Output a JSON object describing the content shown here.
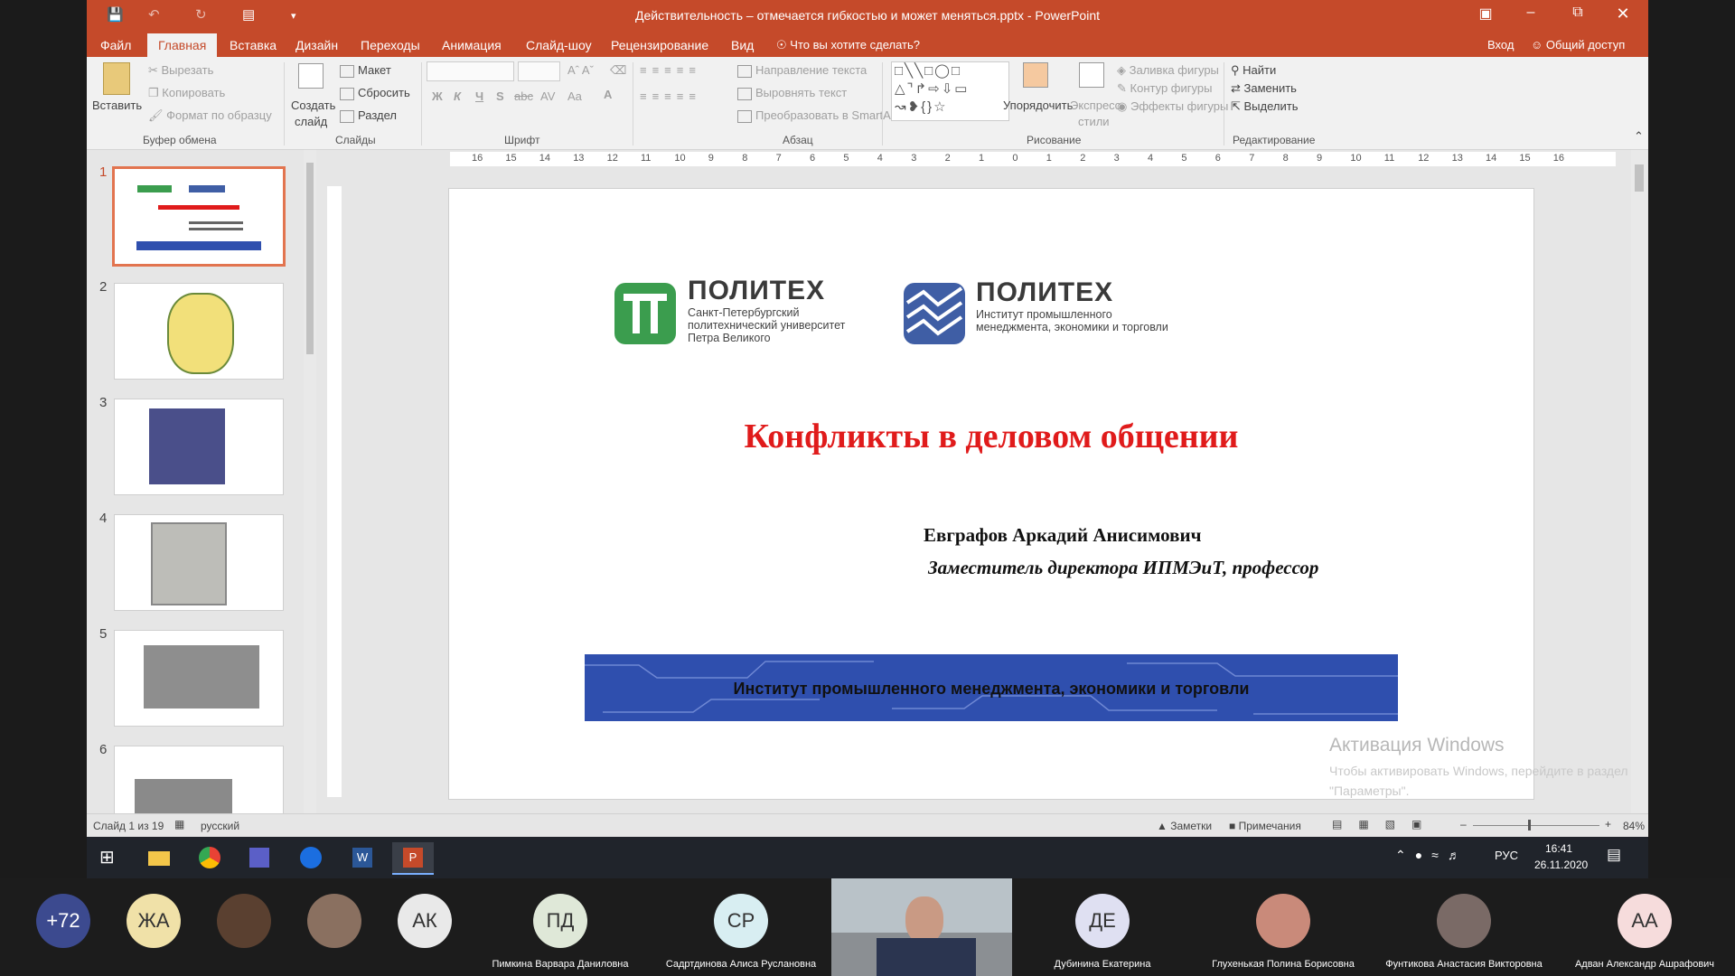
{
  "window": {
    "title": "Действительность – отмечается гибкостью и может меняться.pptx - PowerPoint"
  },
  "tabs": [
    {
      "label": "Файл"
    },
    {
      "label": "Главная"
    },
    {
      "label": "Вставка"
    },
    {
      "label": "Дизайн"
    },
    {
      "label": "Переходы"
    },
    {
      "label": "Анимация"
    },
    {
      "label": "Слайд-шоу"
    },
    {
      "label": "Рецензирование"
    },
    {
      "label": "Вид"
    }
  ],
  "tell_me": "Что вы хотите сделать?",
  "account": {
    "signin": "Вход",
    "share": "Общий доступ"
  },
  "ribbon": {
    "clipboard": {
      "paste": "Вставить",
      "cut": "Вырезать",
      "copy": "Копировать",
      "format_painter": "Формат по образцу",
      "group": "Буфер обмена"
    },
    "slides": {
      "new_slide_1": "Создать",
      "new_slide_2": "слайд",
      "layout": "Макет",
      "reset": "Сбросить",
      "section": "Раздел",
      "group": "Слайды"
    },
    "font": {
      "group": "Шрифт",
      "bold": "Ж",
      "italic": "К",
      "underline": "Ч",
      "strike": "S",
      "abc": "abc",
      "spacing": "AV",
      "case": "Aa"
    },
    "paragraph": {
      "text_direction": "Направление текста",
      "align_text": "Выровнять текст",
      "smartart": "Преобразовать в SmartArt",
      "group": "Абзац"
    },
    "drawing": {
      "arrange": "Упорядочить",
      "quick_styles_1": "Экспресс-",
      "quick_styles_2": "стили",
      "fill": "Заливка фигуры",
      "outline": "Контур фигуры",
      "effects": "Эффекты фигуры",
      "group": "Рисование"
    },
    "editing": {
      "find": "Найти",
      "replace": "Заменить",
      "select": "Выделить",
      "group": "Редактирование"
    }
  },
  "thumbnails": [
    "1",
    "2",
    "3",
    "4",
    "5",
    "6"
  ],
  "hruler": [
    "16",
    "15",
    "14",
    "13",
    "12",
    "11",
    "10",
    "9",
    "8",
    "7",
    "6",
    "5",
    "4",
    "3",
    "2",
    "1",
    "0",
    "1",
    "2",
    "3",
    "4",
    "5",
    "6",
    "7",
    "8",
    "9",
    "10",
    "11",
    "12",
    "13",
    "14",
    "15",
    "16"
  ],
  "slide": {
    "logo1": {
      "name": "ПОЛИТЕХ",
      "sub1": "Санкт-Петербургский",
      "sub2": "политехнический университет",
      "sub3": "Петра Великого"
    },
    "logo2": {
      "name": "ПОЛИТЕХ",
      "sub1": "Институт промышленного",
      "sub2": "менеджмента, экономики и торговли"
    },
    "title": "Конфликты в деловом общении",
    "author": "Евграфов Аркадий Анисимович",
    "position": "Заместитель директора   ИПМЭиТ, профессор",
    "banner": "Институт промышленного менеджмента, экономики и торговли"
  },
  "activation": {
    "title": "Активация Windows",
    "line1": "Чтобы активировать Windows, перейдите в раздел",
    "line2": "\"Параметры\"."
  },
  "status": {
    "slide": "Слайд 1 из 19",
    "language": "русский",
    "notes": "Заметки",
    "comments": "Примечания",
    "zoom": "84%"
  },
  "tray": {
    "lang": "РУС",
    "time": "16:41",
    "date": "26.11.2020"
  },
  "participants": [
    {
      "initials": "+72",
      "color": "#3c4a8f",
      "text": "#ffffff"
    },
    {
      "initials": "ЖА",
      "color": "#f0e1a8",
      "text": "#333333"
    },
    {
      "initials": "",
      "color": "#5a4030",
      "text": "#ffffff"
    },
    {
      "initials": "",
      "color": "#8a7060",
      "text": "#ffffff"
    },
    {
      "initials": "АК",
      "color": "#e9e9e9",
      "text": "#333333"
    },
    {
      "initials": "ПД",
      "color": "#dfe8d8",
      "text": "#333333",
      "name": "Пимкина Варвара Даниловна"
    },
    {
      "initials": "СР",
      "color": "#d8eef2",
      "text": "#333333",
      "name": "Садртдинова Алиса Руслановна"
    },
    {
      "initials": "",
      "name": ""
    },
    {
      "initials": "ДЕ",
      "color": "#dfe0f2",
      "text": "#333333",
      "name": "Дубинина Екатерина"
    },
    {
      "initials": "",
      "color": "#c98a7a",
      "text": "#ffffff",
      "name": "Глухенькая Полина Борисовна"
    },
    {
      "initials": "",
      "color": "#7a6a66",
      "text": "#ffffff",
      "name": "Фунтикова Анастасия Викторовна"
    },
    {
      "initials": "АА",
      "color": "#f6dcdc",
      "text": "#333333",
      "name": "Адван Александр Ашрафович"
    }
  ]
}
